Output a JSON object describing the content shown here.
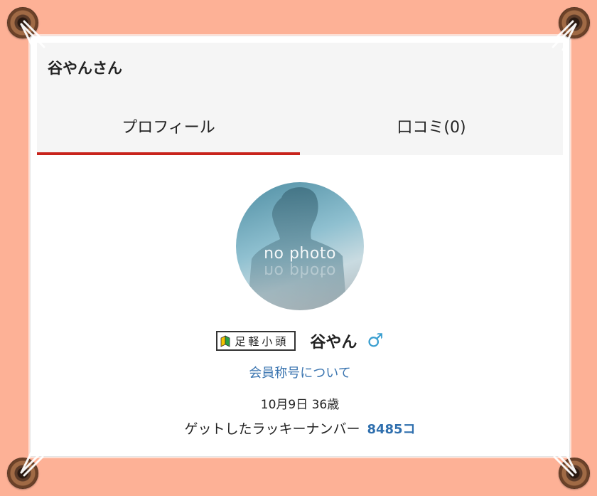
{
  "header": {
    "title": "谷やんさん"
  },
  "tabs": [
    {
      "label": "プロフィール",
      "active": true
    },
    {
      "label": "口コミ(0)",
      "active": false
    }
  ],
  "profile": {
    "avatar_text": "no photo",
    "rank_badge": "足軽小頭",
    "name": "谷やん",
    "gender_icon": "♂",
    "title_link": "会員称号について",
    "birthday": "10月9日 36歳",
    "lucky_label": "ゲットしたラッキーナンバー",
    "lucky_value": "8485コ"
  },
  "colors": {
    "background": "#fdb196",
    "active_tab_underline": "#c8231c",
    "link": "#3b75b0",
    "male_icon": "#3a9fd0"
  }
}
